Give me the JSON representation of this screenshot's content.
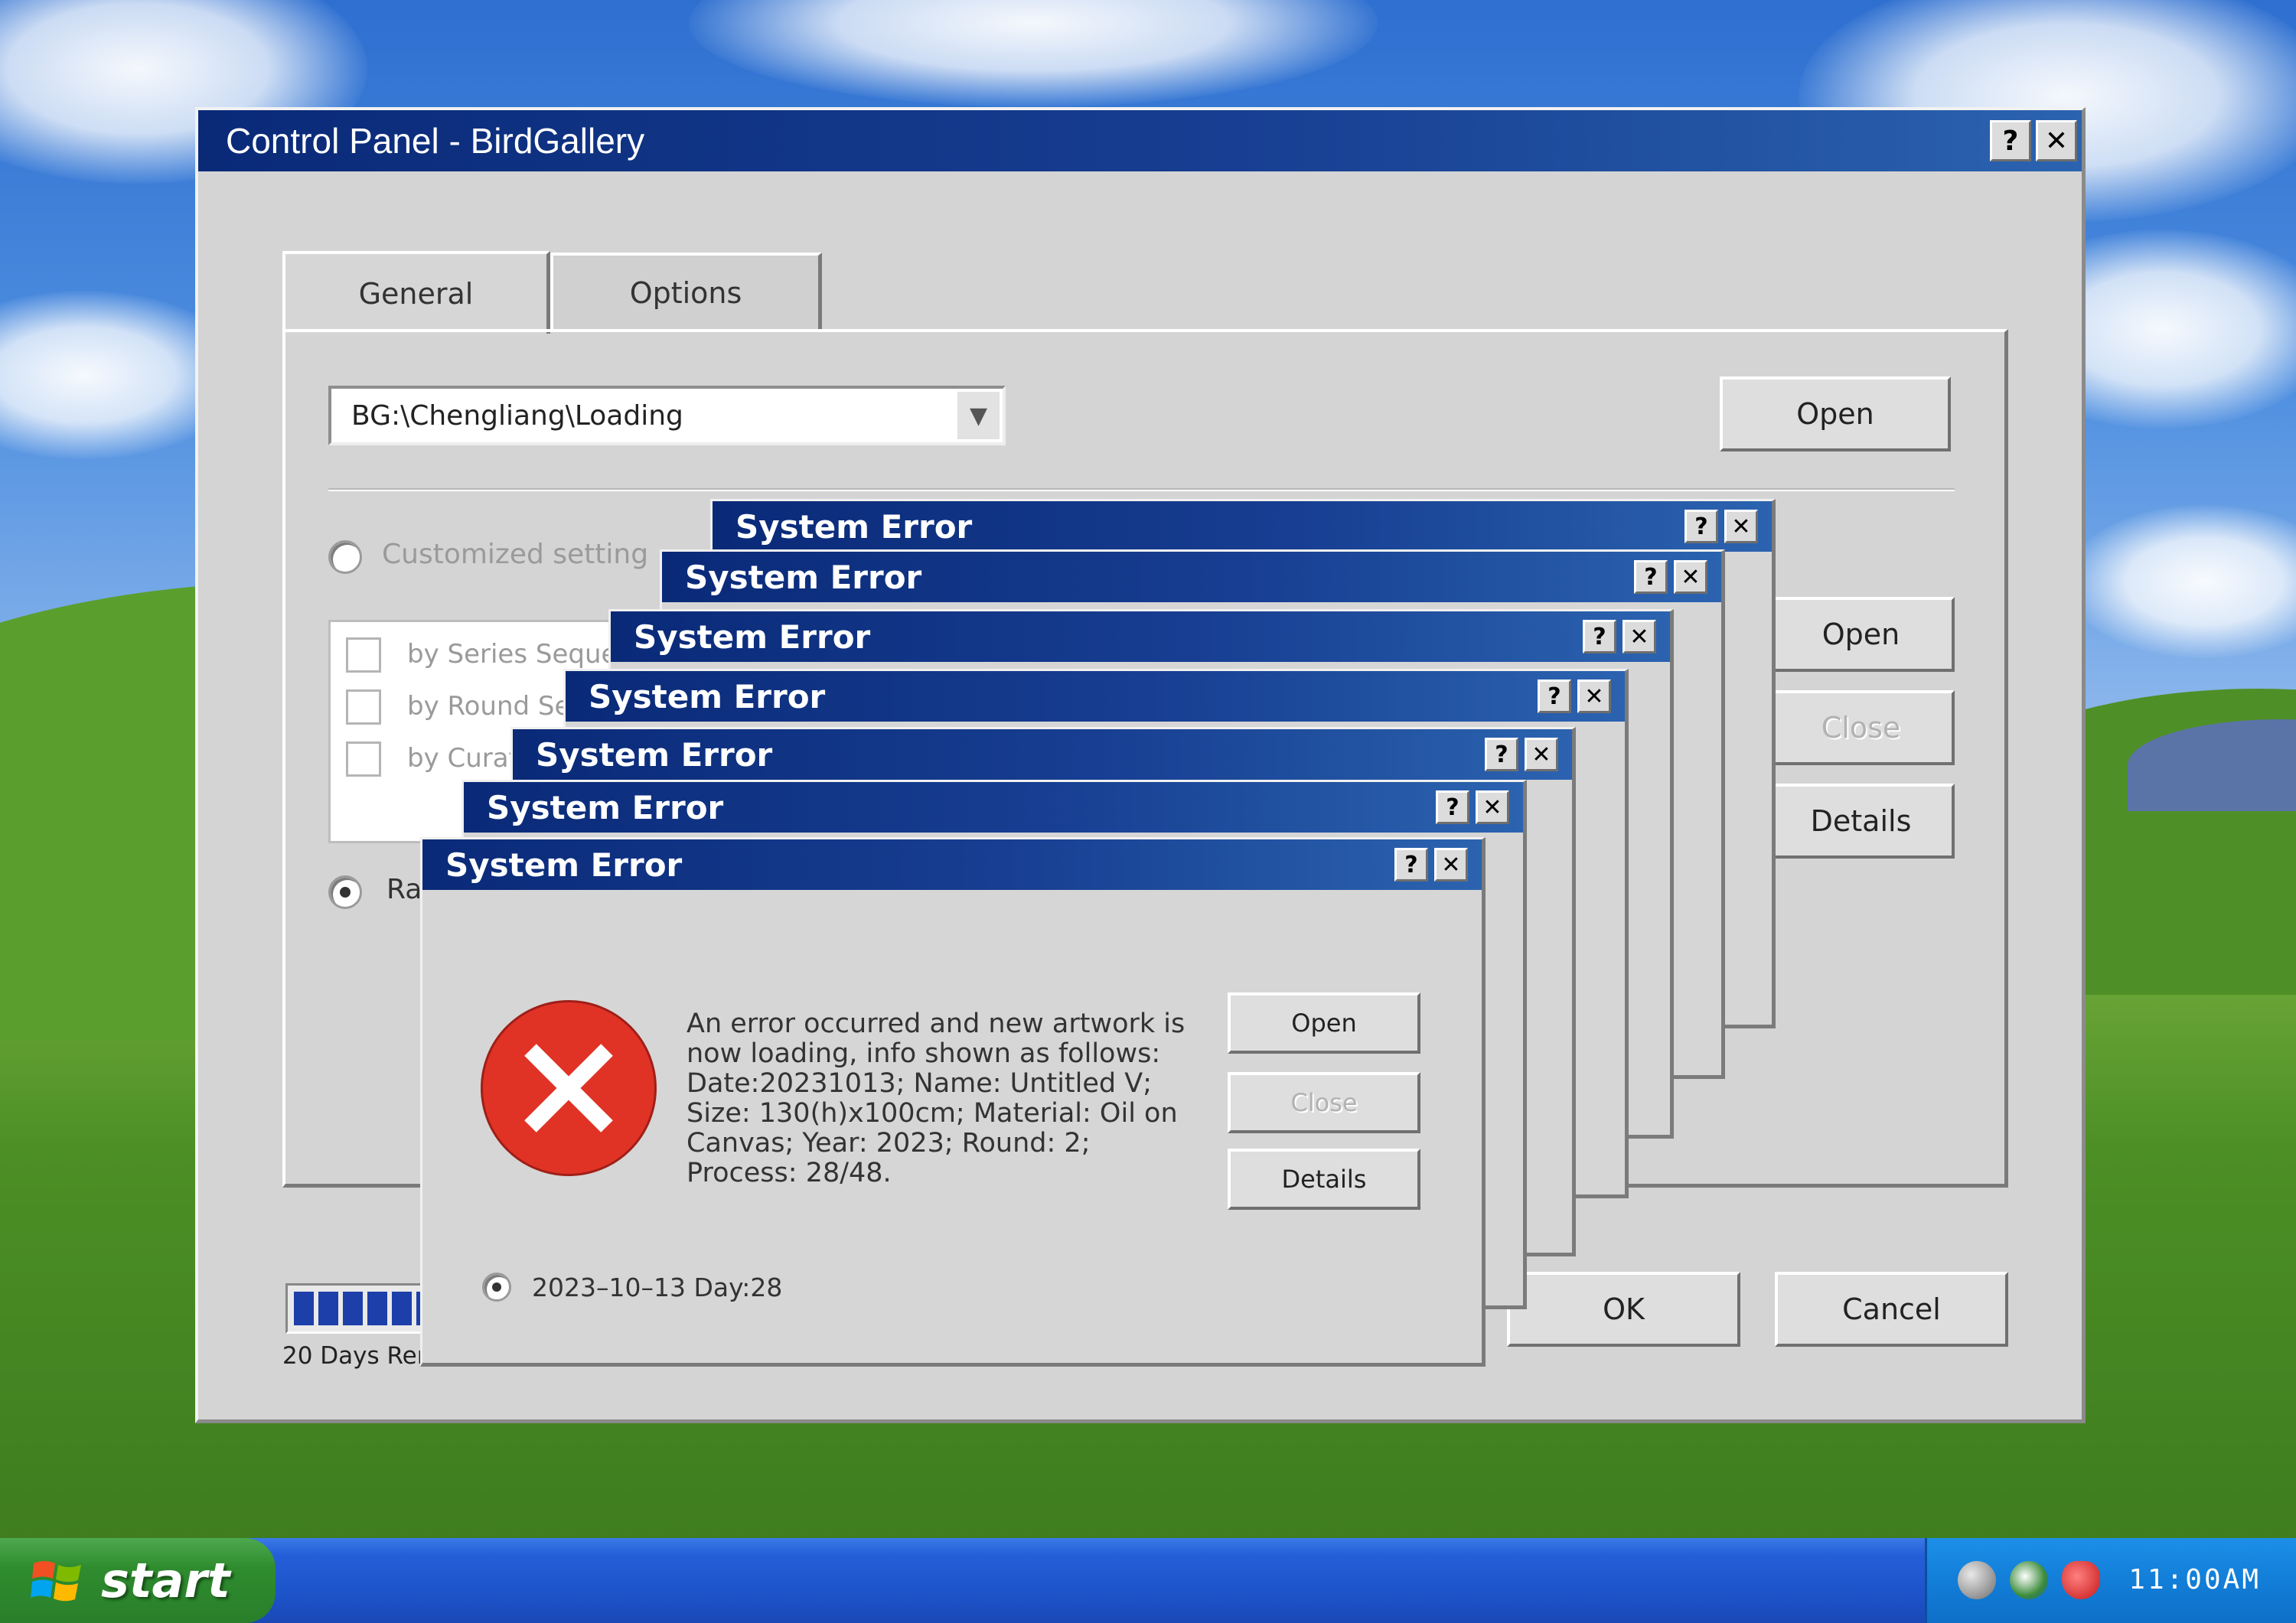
{
  "control_panel": {
    "title": "Control Panel - BirdGallery",
    "help_label": "?",
    "close_label": "✕",
    "tabs": [
      {
        "label": "General"
      },
      {
        "label": "Options"
      }
    ],
    "path_value": "BG:\\Chengliang\\Loading",
    "open_label": "Open",
    "customized_setting_label": "Customized setting",
    "sort_options": [
      {
        "label": "by Series Seque"
      },
      {
        "label": "by Round Se"
      },
      {
        "label": "by Curat"
      }
    ],
    "random_label": "Ra",
    "side_buttons": {
      "open": "Open",
      "close": "Close",
      "details": "Details"
    },
    "progress": {
      "filled_segments": 7,
      "label": "20 Days Ren"
    },
    "ok_label": "OK",
    "cancel_label": "Cancel"
  },
  "error_dialog": {
    "title": "System Error",
    "help_label": "?",
    "close_label": "✕",
    "message": "An error occurred and new artwork is now loading, info shown as follows: Date:20231013; Name: Untitled V; Size: 130(h)x100cm; Material: Oil on Canvas; Year: 2023; Round: 2; Process: 28/48.",
    "buttons": {
      "open": "Open",
      "close": "Close",
      "details": "Details"
    },
    "radio_label": "2023–10–13 Day:28",
    "icon": "error-x-icon"
  },
  "taskbar": {
    "start_label": "start",
    "clock": "11:00AM",
    "tray_icons": [
      "speaker-icon",
      "network-icon",
      "security-shield-icon"
    ]
  },
  "colors": {
    "title_bar_start": "#0a2a78",
    "title_bar_end": "#2b63b0",
    "error_red": "#e03326",
    "window_face": "#d4d4d4"
  }
}
